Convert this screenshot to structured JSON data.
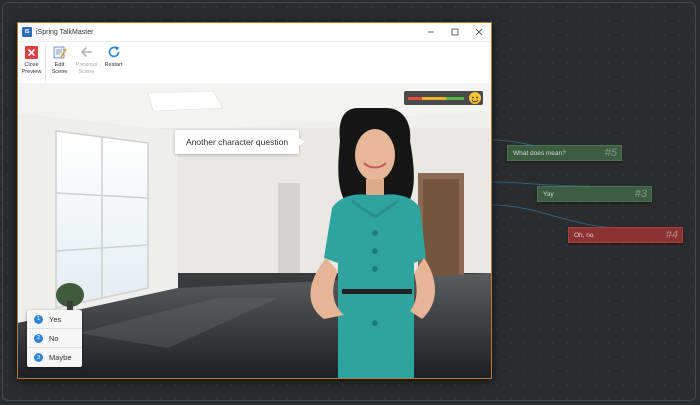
{
  "window": {
    "app_logo_text": "iS",
    "title": "iSpring TalkMaster",
    "controls": {
      "minimize_icon": "minimize-icon",
      "maximize_icon": "maximize-icon",
      "close_icon": "close-icon"
    }
  },
  "toolbar": {
    "items": [
      {
        "label": "Close\nPreview",
        "icon": "close-preview-icon",
        "enabled": true
      },
      {
        "label": "Edit\nScene",
        "icon": "edit-scene-icon",
        "enabled": true
      },
      {
        "label": "Previous\nScene",
        "icon": "previous-scene-icon",
        "enabled": false
      },
      {
        "label": "Restart",
        "icon": "restart-icon",
        "enabled": true
      }
    ]
  },
  "scene": {
    "speech_bubble": "Another character question",
    "mood_meter": {
      "level": 0.85,
      "colors": [
        "#e34b3b",
        "#f0b22b",
        "#55b848"
      ],
      "emotion_icon": "smiley-icon"
    },
    "answers": [
      {
        "number": "1",
        "label": "Yes"
      },
      {
        "number": "2",
        "label": "No"
      },
      {
        "number": "3",
        "label": "Maybe"
      }
    ]
  },
  "graph_nodes": [
    {
      "label": "What does mean?",
      "number": "#5",
      "color": "#3d5d43"
    },
    {
      "label": "Yay",
      "number": "#3",
      "color": "#3d5d43"
    },
    {
      "label": "Oh, no",
      "number": "#4",
      "color": "#8c3232"
    }
  ],
  "colors": {
    "accent": "#2f86d6",
    "window_border": "#b47a3c",
    "background": "#2b2c2e"
  }
}
